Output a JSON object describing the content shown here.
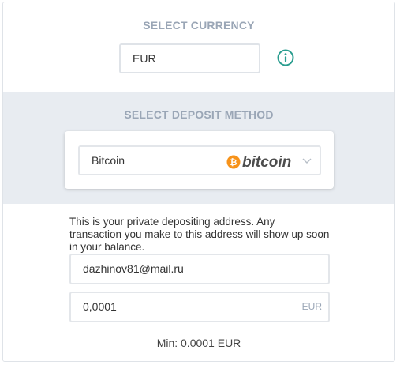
{
  "currency": {
    "title": "SELECT CURRENCY",
    "value": "EUR",
    "info_icon": "info-circle-icon"
  },
  "deposit": {
    "title": "SELECT DEPOSIT METHOD",
    "method": "Bitcoin",
    "logo_text": "bitcoin",
    "logo_glyph": "₿",
    "logo_color": "#f7931a",
    "chevron_icon": "chevron-down-icon"
  },
  "address": {
    "description": "This is your private depositing address. Any transaction you make to this address will show up soon in your balance.",
    "email": "dazhinov81@mail.ru",
    "amount": "0,0001",
    "amount_unit": "EUR",
    "min_text": "Min: 0.0001 EUR"
  },
  "colors": {
    "accent": "#2a9d8f",
    "band": "#e8ecf1",
    "title": "#9aa6b6"
  }
}
